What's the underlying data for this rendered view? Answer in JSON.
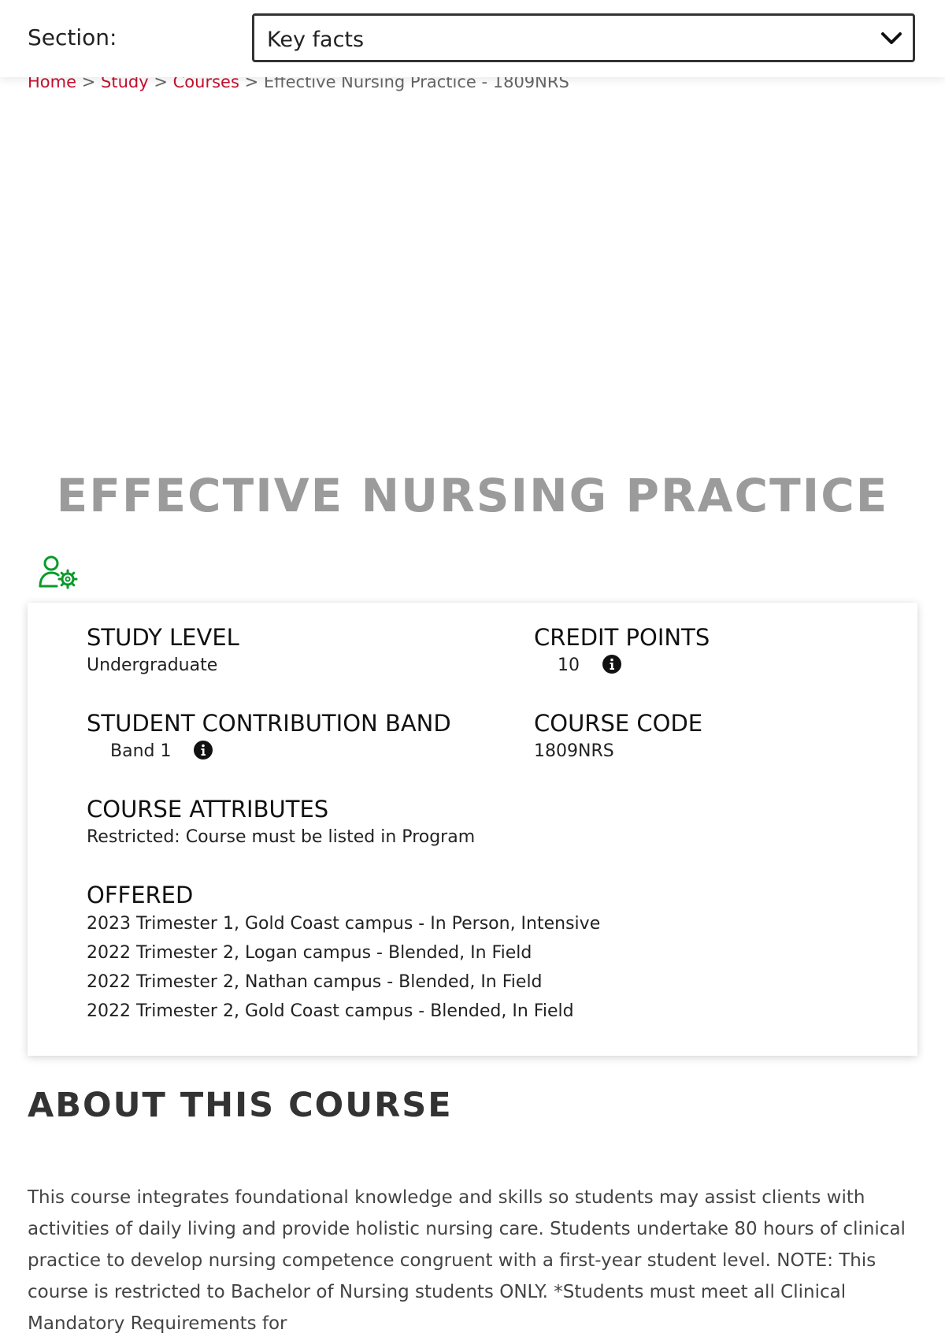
{
  "section_bar": {
    "label": "Section:",
    "selected": "Key facts"
  },
  "breadcrumb": {
    "home": "Home",
    "study": "Study",
    "courses": "Courses",
    "sep": ">",
    "current": "Effective Nursing Practice - 1809NRS"
  },
  "course": {
    "title": "EFFECTIVE NURSING PRACTICE"
  },
  "facts": {
    "study_level": {
      "heading": "STUDY LEVEL",
      "value": "Undergraduate"
    },
    "credit_points": {
      "heading": "CREDIT POINTS",
      "value": "10"
    },
    "contribution_band": {
      "heading": "STUDENT CONTRIBUTION BAND",
      "value": "Band 1"
    },
    "course_code": {
      "heading": "COURSE CODE",
      "value": "1809NRS"
    },
    "attributes": {
      "heading": "COURSE ATTRIBUTES",
      "value": "Restricted: Course must be listed in Program"
    },
    "offered": {
      "heading": "OFFERED",
      "items": [
        "2023 Trimester 1, Gold Coast campus - In Person, Intensive",
        "2022 Trimester 2, Logan campus - Blended, In Field",
        "2022 Trimester 2, Nathan campus - Blended, In Field",
        "2022 Trimester 2, Gold Coast campus - Blended, In Field"
      ]
    }
  },
  "about": {
    "heading": "ABOUT THIS COURSE",
    "text": "This course integrates foundational knowledge and skills so students may assist clients with activities of daily living and provide holistic nursing care. Students undertake 80 hours of clinical practice to develop nursing competence congruent with a first-year student level. NOTE: This course is restricted to Bachelor of Nursing students ONLY. *Students must meet all Clinical Mandatory Requirements for"
  },
  "colors": {
    "link": "#c8102e",
    "title": "#9b9b9b",
    "icon_green": "#0a9a2a"
  },
  "icons": {
    "select": "chevron-down-icon",
    "user_settings": "user-gear-icon",
    "info": "info-icon"
  }
}
